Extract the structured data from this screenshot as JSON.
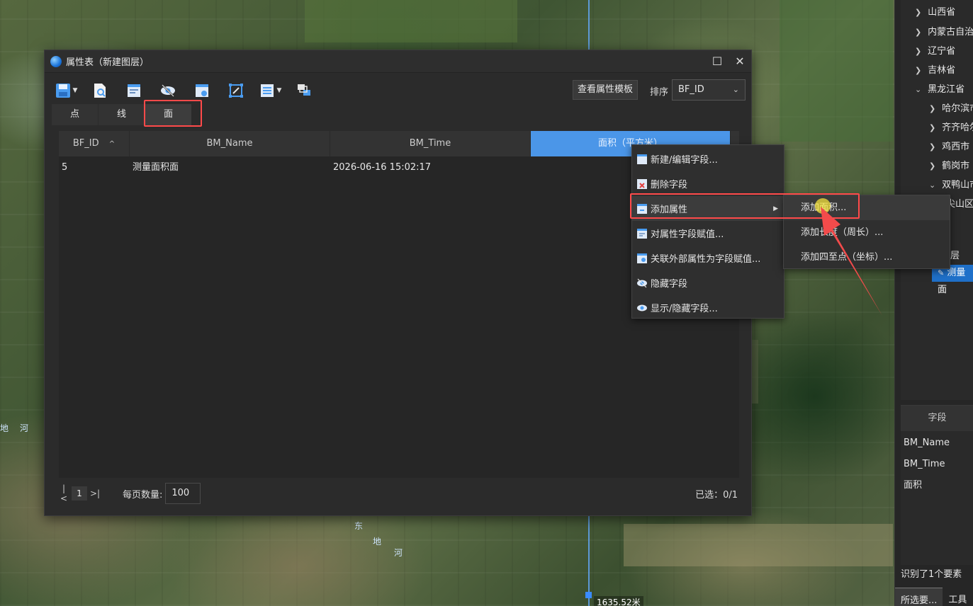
{
  "map": {
    "river_labels": [
      "东",
      "地",
      "河"
    ],
    "river_labels_left": [
      "地",
      "河"
    ],
    "measure_text": "1635.52米"
  },
  "dialog": {
    "title": "属性表（新建图层）",
    "toolbar": {
      "icons": [
        "save-icon",
        "export-icon",
        "edit-icon",
        "hide-icon",
        "field-icon",
        "zoom-extent-icon",
        "list-icon",
        "layers-icon"
      ]
    },
    "template_button": "查看属性模板",
    "sort_label": "排序",
    "sort_value": "BF_ID",
    "tabs": [
      {
        "label": "点"
      },
      {
        "label": "线"
      },
      {
        "label": "面"
      }
    ],
    "columns": [
      "BF_ID",
      "BM_Name",
      "BM_Time",
      "面积（平方米）"
    ],
    "rows": [
      {
        "BF_ID": "5",
        "BM_Name": "测量面积面",
        "BM_Time": "2026-06-16 15:02:17",
        "area": ""
      }
    ],
    "pager": {
      "page": "1",
      "per_page_label": "每页数量:",
      "per_page_value": "100",
      "selected": "已选：0/1"
    }
  },
  "context_menu": {
    "items": [
      {
        "label": "新建/编辑字段..."
      },
      {
        "label": "删除字段"
      },
      {
        "label": "添加属性"
      },
      {
        "label": "对属性字段赋值..."
      },
      {
        "label": "关联外部属性为字段赋值..."
      },
      {
        "label": "隐藏字段"
      },
      {
        "label": "显示/隐藏字段..."
      }
    ],
    "submenu": [
      {
        "label": "添加面积..."
      },
      {
        "label": "添加长度（周长）..."
      },
      {
        "label": "添加四至点（坐标）..."
      }
    ]
  },
  "side": {
    "tree": [
      {
        "label": "山西省"
      },
      {
        "label": "内蒙古自治区"
      },
      {
        "label": "辽宁省"
      },
      {
        "label": "吉林省"
      },
      {
        "label": "黑龙江省"
      },
      {
        "label": "哈尔滨市"
      },
      {
        "label": "齐齐哈尔市"
      },
      {
        "label": "鸡西市"
      },
      {
        "label": "鹤岗市"
      },
      {
        "label": "双鸭山市"
      },
      {
        "label": "尖山区"
      }
    ],
    "layer_group": "层",
    "layer_selected": "测量面",
    "fields_header": "字段",
    "fields": [
      "BM_Name",
      "BM_Time",
      "面积"
    ],
    "status": "识别了1个要素",
    "tabs": [
      "所选要...",
      "工具"
    ]
  },
  "colors": {
    "accent": "#4b96e8",
    "highlight": "#ff4a4a",
    "panel": "#2b2b2b"
  }
}
